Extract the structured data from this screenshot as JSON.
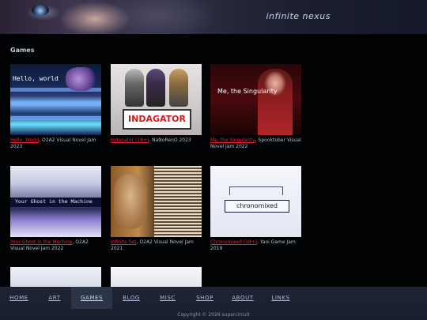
{
  "site": {
    "title": "infinite nexus"
  },
  "section": {
    "heading": "Games"
  },
  "games": [
    {
      "thumb_text": "Hello, world",
      "title": "Hello, World",
      "meta": ", O2A2 Visual Novel Jam 2023"
    },
    {
      "thumb_text": "INDAGATOR",
      "title": "Indagator (18+)",
      "meta": ", NaNoRenO 2023"
    },
    {
      "thumb_text": "Me, the Singularity",
      "title": "Me, the Singularity",
      "meta": ", Spooktober Visual Novel Jam 2022"
    },
    {
      "thumb_text": "Your Ghost in the Machine",
      "title": "Your Ghost in the Machine",
      "meta": ", O2A2 Visual Novel Jam 2022"
    },
    {
      "title": "Infinite Set",
      "meta": ", O2A2 Visual Novel Jam 2021"
    },
    {
      "thumb_text": "chronomixed",
      "title": "Chronomixed (18+)",
      "meta": ", Yaoi Game Jam 2019"
    }
  ],
  "nav": {
    "items": [
      {
        "label": "HOME"
      },
      {
        "label": "ART"
      },
      {
        "label": "GAMES"
      },
      {
        "label": "BLOG"
      },
      {
        "label": "MISC"
      },
      {
        "label": "SHOP"
      },
      {
        "label": "ABOUT"
      },
      {
        "label": "LINKS"
      }
    ],
    "active": "GAMES"
  },
  "footer": {
    "copyright": "Copyright © 2026 supercircuit"
  }
}
